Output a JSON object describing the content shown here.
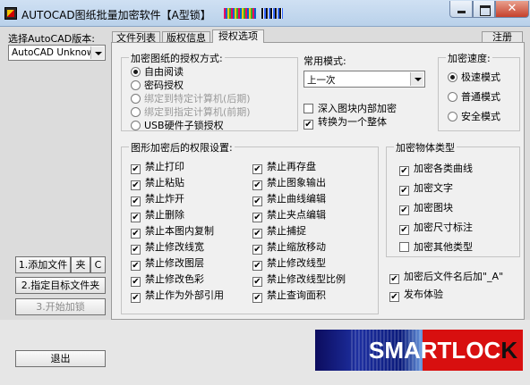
{
  "window": {
    "title": "AUTOCAD图纸批量加密软件【A型锁】",
    "close_symbol": "✕"
  },
  "sidebar": {
    "version_label": "选择AutoCAD版本:",
    "version_value": "AutoCAD Unknow",
    "add_files": "1.添加文件",
    "folder": "夹",
    "clear": "C",
    "set_target": "2.指定目标文件夹",
    "start": "3.开始加锁",
    "exit": "退出"
  },
  "tabs": [
    "文件列表",
    "版权信息",
    "授权选项"
  ],
  "help_tab": "注册",
  "auth": {
    "title": "加密图纸的授权方式:",
    "options": [
      {
        "label": "自由阅读",
        "selected": true,
        "enabled": true
      },
      {
        "label": "密码授权",
        "selected": false,
        "enabled": true
      },
      {
        "label": "绑定到特定计算机(后期)",
        "selected": false,
        "enabled": false
      },
      {
        "label": "绑定到指定计算机(前期)",
        "selected": false,
        "enabled": false
      },
      {
        "label": "USB硬件子锁授权",
        "selected": false,
        "enabled": true
      }
    ]
  },
  "mode": {
    "title": "常用模式:",
    "value": "上一次",
    "deep_encrypt": "深入图块内部加密",
    "deep_encrypt_checked": false,
    "convert_whole": "转换为一个整体",
    "convert_whole_checked": true
  },
  "speed": {
    "title": "加密速度:",
    "options": [
      {
        "label": "极速模式",
        "selected": true
      },
      {
        "label": "普通模式",
        "selected": false
      },
      {
        "label": "安全模式",
        "selected": false
      }
    ]
  },
  "perm": {
    "title": "图形加密后的权限设置:",
    "col1": [
      "禁止打印",
      "禁止粘贴",
      "禁止炸开",
      "禁止删除",
      "禁止本图内复制",
      "禁止修改线宽",
      "禁止修改图层",
      "禁止修改色彩",
      "禁止作为外部引用"
    ],
    "col2": [
      "禁止再存盘",
      "禁止图象输出",
      "禁止曲线编辑",
      "禁止夹点编辑",
      "禁止捕捉",
      "禁止缩放移动",
      "禁止修改线型",
      "禁止修改线型比例",
      "禁止查询面积"
    ]
  },
  "objtype": {
    "title": "加密物体类型",
    "items": [
      {
        "label": "加密各类曲线",
        "checked": true
      },
      {
        "label": "加密文字",
        "checked": true
      },
      {
        "label": "加密图块",
        "checked": true
      },
      {
        "label": "加密尺寸标注",
        "checked": true
      },
      {
        "label": "加密其他类型",
        "checked": false
      }
    ]
  },
  "extra": {
    "suffix": "加密后文件名后加\"_A\"",
    "suffix_checked": true,
    "publish": "发布体验",
    "publish_checked": true
  },
  "logo": {
    "text_main": "SMARTLOC",
    "text_k": "K"
  },
  "check_symbol": "✔"
}
